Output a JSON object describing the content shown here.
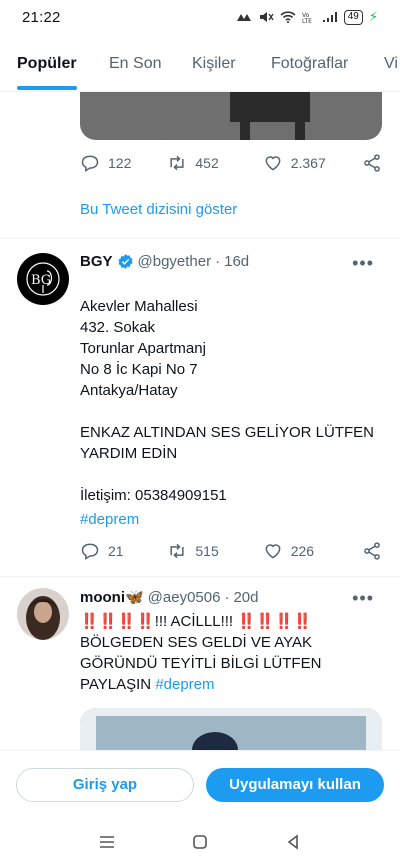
{
  "status_bar": {
    "time": "21:22",
    "battery": "49"
  },
  "tabs": [
    {
      "label": "Popüler",
      "active": true
    },
    {
      "label": "En Son",
      "active": false
    },
    {
      "label": "Kişiler",
      "active": false
    },
    {
      "label": "Fotoğraflar",
      "active": false
    },
    {
      "label": "Vi",
      "active": false
    }
  ],
  "tweet1": {
    "replies": "122",
    "retweets": "452",
    "likes": "2.367",
    "show_thread": "Bu Tweet dizisini göster"
  },
  "tweet2": {
    "name": "BGY",
    "handle": "@bgyether",
    "time": "16d",
    "text": "Akevler Mahallesi\n432. Sokak\nTorunlar Apartmanj\nNo 8 İc Kapi No 7\nAntakya/Hatay\n\nENKAZ ALTINDAN SES GELİYOR LÜTFEN YARDIM EDİN\n\nİletişim: 05384909151",
    "hashtag": "#deprem",
    "replies": "21",
    "retweets": "515",
    "likes": "226"
  },
  "tweet3": {
    "name": "mooni🦋",
    "handle": "@aey0506",
    "time": "20d",
    "text": "‼️‼️‼️‼️!!! ACİLLL!!!  ‼️‼️‼️‼️ BÖLGEDEN SES GELDİ VE AYAK GÖRÜNDÜ TEYİTLİ BİLGİ LÜTFEN PAYLAŞIN ",
    "hashtag": "#deprem"
  },
  "cta": {
    "login": "Giriş yap",
    "app": "Uygulamayı kullan"
  },
  "colors": {
    "accent": "#1d9bf0",
    "text": "#0f1419",
    "muted": "#536471"
  }
}
